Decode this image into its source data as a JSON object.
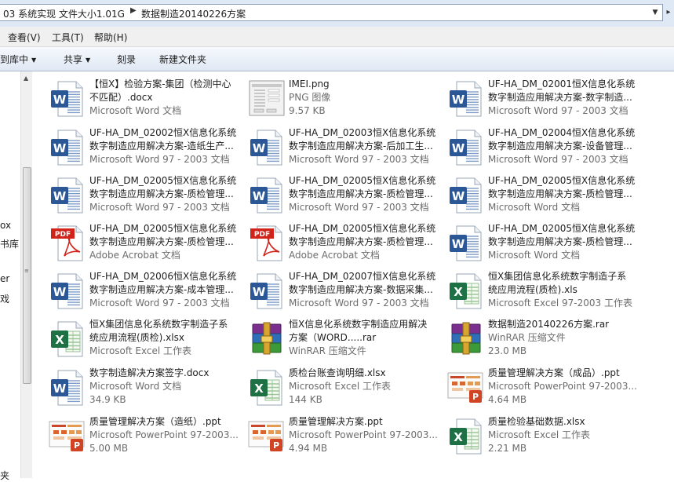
{
  "address": {
    "crumbs": [
      "03 系统实现 文件大小1.01G",
      "数据制造20140226方案"
    ]
  },
  "menu": [
    "查看(V)",
    "工具(T)",
    "帮助(H)"
  ],
  "toolbar": {
    "include_library": "到库中",
    "share": "共享",
    "burn": "刻录",
    "new_folder": "新建文件夹"
  },
  "nav": [
    "ox",
    "书库",
    "er",
    "戏",
    "夹"
  ],
  "files": [
    {
      "icon": "word-icon",
      "lines": [
        "【恒X】检验方案-集团（检测中心",
        "不匹配）.docx",
        "Microsoft Word 文档"
      ]
    },
    {
      "icon": "png-thumbnail-icon",
      "lines": [
        "IMEI.png",
        "PNG 图像",
        "9.57 KB"
      ]
    },
    {
      "icon": "word-icon",
      "lines": [
        "UF-HA_DM_02001恒X信息化系统",
        "数字制造应用解决方案-数字制造...",
        "Microsoft Word 97 - 2003 文档"
      ]
    },
    {
      "icon": "word-icon",
      "lines": [
        "UF-HA_DM_02002恒X信息化系统",
        "数字制造应用解决方案-造纸生产...",
        "Microsoft Word 97 - 2003 文档"
      ]
    },
    {
      "icon": "word-icon",
      "lines": [
        "UF-HA_DM_02003恒X信息化系统",
        "数字制造应用解决方案-后加工生...",
        "Microsoft Word 97 - 2003 文档"
      ]
    },
    {
      "icon": "word-icon",
      "lines": [
        "UF-HA_DM_02004恒X信息化系统",
        "数字制造应用解决方案-设备管理...",
        "Microsoft Word 97 - 2003 文档"
      ]
    },
    {
      "icon": "word-icon",
      "lines": [
        "UF-HA_DM_02005恒X信息化系统",
        "数字制造应用解决方案-质检管理...",
        "Microsoft Word 97 - 2003 文档"
      ]
    },
    {
      "icon": "word-icon",
      "lines": [
        "UF-HA_DM_02005恒X信息化系统",
        "数字制造应用解决方案-质检管理...",
        "Microsoft Word 97 - 2003 文档"
      ]
    },
    {
      "icon": "word-icon",
      "lines": [
        "UF-HA_DM_02005恒X信息化系统",
        "数字制造应用解决方案-质检管理...",
        "Microsoft Word 文档"
      ]
    },
    {
      "icon": "pdf-icon",
      "lines": [
        "UF-HA_DM_02005恒X信息化系统",
        "数字制造应用解决方案-质检管理...",
        "Adobe Acrobat 文档"
      ]
    },
    {
      "icon": "pdf-icon",
      "lines": [
        "UF-HA_DM_02005恒X信息化系统",
        "数字制造应用解决方案-质检管理...",
        "Adobe Acrobat 文档"
      ]
    },
    {
      "icon": "word-icon",
      "lines": [
        "UF-HA_DM_02005恒X信息化系统",
        "数字制造应用解决方案-质检管理...",
        "Microsoft Word 文档"
      ]
    },
    {
      "icon": "word-icon",
      "lines": [
        "UF-HA_DM_02006恒X信息化系统",
        "数字制造应用解决方案-成本管理...",
        "Microsoft Word 97 - 2003 文档"
      ]
    },
    {
      "icon": "word-icon",
      "lines": [
        "UF-HA_DM_02007恒X信息化系统",
        "数字制造应用解决方案-数据采集...",
        "Microsoft Word 97 - 2003 文档"
      ]
    },
    {
      "icon": "excel-icon",
      "lines": [
        "恒X集团信息化系统数字制造子系",
        "统应用流程(质检).xls",
        "Microsoft Excel 97-2003 工作表"
      ]
    },
    {
      "icon": "excel-icon",
      "lines": [
        "恒X集团信息化系统数字制造子系",
        "统应用流程(质检).xlsx",
        "Microsoft Excel 工作表"
      ]
    },
    {
      "icon": "rar-icon",
      "lines": [
        "恒X信息化系统数字制造应用解决",
        "方案（WORD.....rar",
        "WinRAR 压缩文件"
      ]
    },
    {
      "icon": "rar-icon",
      "lines": [
        "数据制造20140226方案.rar",
        "WinRAR 压缩文件",
        "23.0 MB"
      ]
    },
    {
      "icon": "word-icon",
      "lines": [
        "数字制造解决方案签字.docx",
        "Microsoft Word 文档",
        "34.9 KB"
      ]
    },
    {
      "icon": "excel-icon",
      "lines": [
        "质检台账查询明细.xlsx",
        "Microsoft Excel 工作表",
        "144 KB"
      ]
    },
    {
      "icon": "ppt-icon",
      "lines": [
        "质量管理解决方案（成品）.ppt",
        "Microsoft PowerPoint 97-2003...",
        "4.64 MB"
      ]
    },
    {
      "icon": "ppt-icon",
      "lines": [
        "质量管理解决方案（造纸）.ppt",
        "Microsoft PowerPoint 97-2003...",
        "5.00 MB"
      ]
    },
    {
      "icon": "ppt-icon",
      "lines": [
        "质量管理解决方案.ppt",
        "Microsoft PowerPoint 97-2003...",
        "4.94 MB"
      ]
    },
    {
      "icon": "excel-icon",
      "lines": [
        "质量检验基础数据.xlsx",
        "Microsoft Excel 工作表",
        "2.21 MB"
      ]
    }
  ]
}
